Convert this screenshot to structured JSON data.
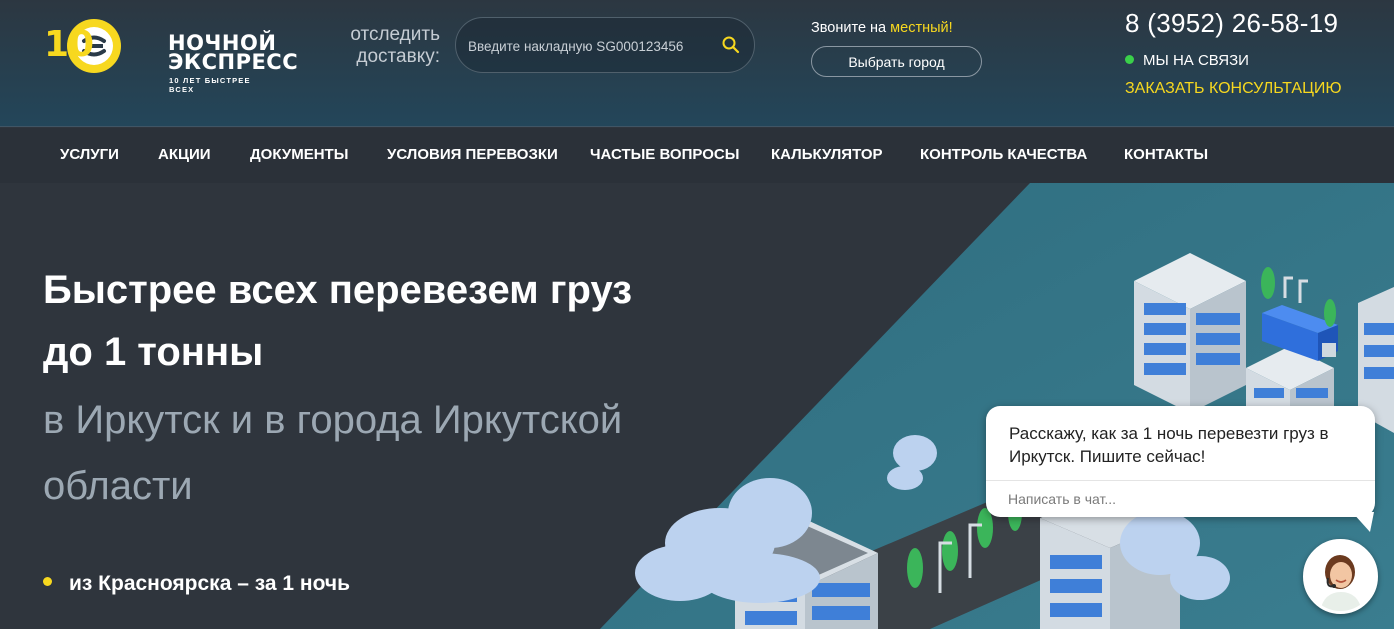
{
  "header": {
    "logo": {
      "word_line1": "НОЧНОЙ",
      "word_line2": "ЭКСПРЕСС",
      "slogan": "10 ЛЕТ БЫСТРЕЕ ВСЕХ",
      "badge_number": "10"
    },
    "track": {
      "label_line1": "отследить",
      "label_line2": "доставку:",
      "placeholder": "Введите накладную SG000123456",
      "value": "",
      "icon": "search-icon"
    },
    "call": {
      "prefix": "Звоните на ",
      "highlight": "местный!",
      "city_button": "Выбрать город"
    },
    "contact": {
      "phone": "8 (3952) 26-58-19",
      "online_status": "МЫ НА СВЯЗИ",
      "consult_link": "ЗАКАЗАТЬ КОНСУЛЬТАЦИЮ"
    }
  },
  "nav": {
    "items": [
      {
        "label": "УСЛУГИ"
      },
      {
        "label": "АКЦИИ"
      },
      {
        "label": "ДОКУМЕНТЫ"
      },
      {
        "label": "УСЛОВИЯ ПЕРЕВОЗКИ"
      },
      {
        "label": "ЧАСТЫЕ ВОПРОСЫ"
      },
      {
        "label": "КАЛЬКУЛЯТОР"
      },
      {
        "label": "КОНТРОЛЬ КАЧЕСТВА"
      },
      {
        "label": "КОНТАКТЫ"
      }
    ]
  },
  "hero": {
    "title_line1": "Быстрее всех перевезем груз",
    "title_line2": "до 1 тонны",
    "subtitle_line1": "в Иркутск и в города Иркутской",
    "subtitle_line2": "области",
    "bullets": [
      "из Красноярска – за 1 ночь"
    ]
  },
  "chat": {
    "message": "Расскажу, как за 1 ночь перевезти груз в Иркутск. Пишите сейчас!",
    "placeholder": "Написать в чат..."
  },
  "colors": {
    "accent": "#f7d81f",
    "online": "#3ad04a",
    "header_bg": "#23465a",
    "nav_bg": "#2b3139",
    "hero_bg": "#2f353d",
    "subtitle": "#9ca8b3"
  }
}
